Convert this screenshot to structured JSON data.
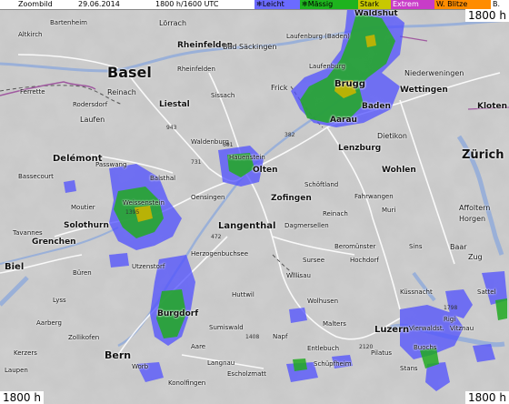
{
  "header": {
    "zoom_label": "Zoombild",
    "date": "29.06.2014",
    "time": "1800 h/1600 UTC"
  },
  "legend": [
    {
      "label": "Leicht",
      "color": "#6b6bff",
      "text_color": "#000000",
      "glyph": "❄"
    },
    {
      "label": "Mässig",
      "color": "#1eb31e",
      "text_color": "#000000",
      "glyph": "❄"
    },
    {
      "label": "Stark",
      "color": "#c8c800",
      "text_color": "#000000"
    },
    {
      "label": "Extrem",
      "color": "#c83cc8",
      "text_color": "#ffffff"
    },
    {
      "label": "W. Blitze",
      "color": "#ff8c00",
      "text_color": "#000000"
    },
    {
      "label": "B.",
      "color": "#ffffff",
      "text_color": "#000000"
    }
  ],
  "corners": {
    "top_right": "1800 h",
    "bottom_left": "1800 h",
    "bottom_right": "1800 h"
  },
  "places": [
    {
      "name": "Altkirch"
    },
    {
      "name": "Bartenheim"
    },
    {
      "name": "Lörrach"
    },
    {
      "name": "Rheinfelden"
    },
    {
      "name": "Rheinfelden"
    },
    {
      "name": "Bad Säckingen"
    },
    {
      "name": "Laufenburg (Baden)"
    },
    {
      "name": "Waldshut"
    },
    {
      "name": "Basel"
    },
    {
      "name": "Laufenburg"
    },
    {
      "name": "Niederweningen"
    },
    {
      "name": "Wettingen"
    },
    {
      "name": "Frick"
    },
    {
      "name": "Reinach"
    },
    {
      "name": "Liestal"
    },
    {
      "name": "Ferrette"
    },
    {
      "name": "Rodersdorf"
    },
    {
      "name": "Brugg"
    },
    {
      "name": "Baden"
    },
    {
      "name": "Kloten"
    },
    {
      "name": "Laufen"
    },
    {
      "name": "Sissach"
    },
    {
      "name": "Aarau"
    },
    {
      "name": "Dietikon"
    },
    {
      "name": "Delémont"
    },
    {
      "name": "Waldenburg"
    },
    {
      "name": "Lenzburg"
    },
    {
      "name": "Zürich"
    },
    {
      "name": "Hauenstein"
    },
    {
      "name": "Olten"
    },
    {
      "name": "Wohlen"
    },
    {
      "name": "Passwang"
    },
    {
      "name": "Balsthal"
    },
    {
      "name": "Schöftland"
    },
    {
      "name": "Fahrwangen"
    },
    {
      "name": "Muri"
    },
    {
      "name": "Affoltern"
    },
    {
      "name": "Bassecourt"
    },
    {
      "name": "Weissenstein"
    },
    {
      "name": "Oensingen"
    },
    {
      "name": "Zofingen"
    },
    {
      "name": "Reinach"
    },
    {
      "name": "Horgen"
    },
    {
      "name": "Moutier"
    },
    {
      "name": "Solothurn"
    },
    {
      "name": "Langenthal"
    },
    {
      "name": "Dagmersellen"
    },
    {
      "name": "Tavannes"
    },
    {
      "name": "Grenchen"
    },
    {
      "name": "Herzogenbuchsee"
    },
    {
      "name": "Beromünster"
    },
    {
      "name": "Sins"
    },
    {
      "name": "Hochdorf"
    },
    {
      "name": "Baar"
    },
    {
      "name": "Zug"
    },
    {
      "name": "Biel"
    },
    {
      "name": "Sursee"
    },
    {
      "name": "Büren"
    },
    {
      "name": "Utzenstorf"
    },
    {
      "name": "Willisau"
    },
    {
      "name": "Huttwil"
    },
    {
      "name": "Küssnacht"
    },
    {
      "name": "Sattel"
    },
    {
      "name": "Lyss"
    },
    {
      "name": "Wolhusen"
    },
    {
      "name": "Burgdorf"
    },
    {
      "name": "Malters"
    },
    {
      "name": "Luzern"
    },
    {
      "name": "Rigi"
    },
    {
      "name": "Vitznau"
    },
    {
      "name": "Aarberg"
    },
    {
      "name": "Zollikofen"
    },
    {
      "name": "Sumiswald"
    },
    {
      "name": "Napf"
    },
    {
      "name": "Entlebuch"
    },
    {
      "name": "Vierwaldst."
    },
    {
      "name": "Buochs"
    },
    {
      "name": "Kerzers"
    },
    {
      "name": "Bern"
    },
    {
      "name": "Langnau"
    },
    {
      "name": "Schüpfheim"
    },
    {
      "name": "Pilatus"
    },
    {
      "name": "Stans"
    },
    {
      "name": "Laupen"
    },
    {
      "name": "Worb"
    },
    {
      "name": "Escholzmatt"
    },
    {
      "name": "Konolfingen"
    },
    {
      "name": "Aare"
    }
  ],
  "peaks": [
    {
      "label": "943"
    },
    {
      "label": "691"
    },
    {
      "label": "1395"
    },
    {
      "label": "1408"
    },
    {
      "label": "2120"
    },
    {
      "label": "1798"
    },
    {
      "label": "731"
    },
    {
      "label": "472"
    },
    {
      "label": "382"
    }
  ],
  "colors": {
    "terrain": "#cfcfcf",
    "road": "#ffffff",
    "water": "#9ab0d8",
    "precip_light": "#5050ff",
    "precip_moderate": "#22aa22",
    "precip_strong": "#c8b400"
  }
}
